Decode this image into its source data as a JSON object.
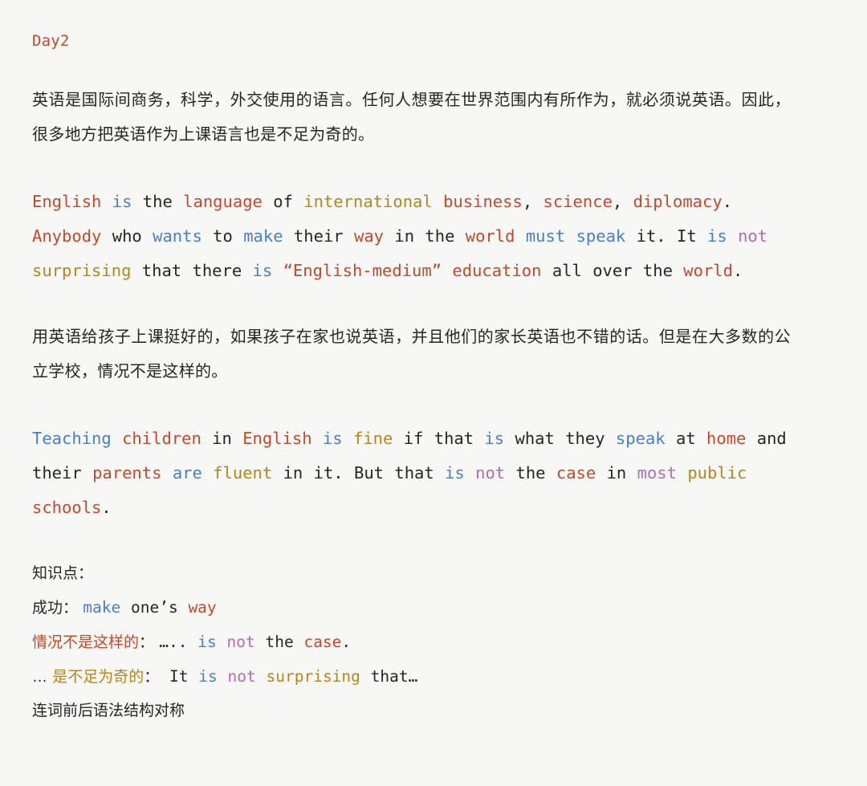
{
  "document": {
    "title": "Day2",
    "title_color": "#c4492b",
    "background_color": "#f7f7f5",
    "palette": {
      "red": "#c4492b",
      "blue": "#4a80c2",
      "gold": "#b5861d",
      "purple": "#b66cad",
      "dark": "#262626"
    }
  },
  "paragraph_cn_1": {
    "text": "英语是国际间商务，科学，外交使用的语言。任何人想要在世界范围内有所作为，就必须说英语。因此，很多地方把英语作为上课语言也是不足为奇的。"
  },
  "paragraph_en_1": {
    "tokens": [
      {
        "t": "English",
        "c": "red"
      },
      {
        "t": " ",
        "c": "dark"
      },
      {
        "t": "is",
        "c": "blue"
      },
      {
        "t": " the ",
        "c": "dark"
      },
      {
        "t": "language",
        "c": "red"
      },
      {
        "t": " of ",
        "c": "dark"
      },
      {
        "t": "international",
        "c": "gold"
      },
      {
        "t": " ",
        "c": "dark"
      },
      {
        "t": "business",
        "c": "red"
      },
      {
        "t": ", ",
        "c": "dark"
      },
      {
        "t": "science",
        "c": "red"
      },
      {
        "t": ", ",
        "c": "dark"
      },
      {
        "t": "diplomacy",
        "c": "red"
      },
      {
        "t": ". ",
        "c": "dark"
      },
      {
        "t": "Anybody",
        "c": "red"
      },
      {
        "t": " who ",
        "c": "dark"
      },
      {
        "t": "wants",
        "c": "blue"
      },
      {
        "t": " to ",
        "c": "dark"
      },
      {
        "t": "make",
        "c": "blue"
      },
      {
        "t": " their ",
        "c": "dark"
      },
      {
        "t": "way",
        "c": "red"
      },
      {
        "t": " in the ",
        "c": "dark"
      },
      {
        "t": "world",
        "c": "red"
      },
      {
        "t": " ",
        "c": "dark"
      },
      {
        "t": "must",
        "c": "blue"
      },
      {
        "t": " ",
        "c": "dark"
      },
      {
        "t": "speak",
        "c": "blue"
      },
      {
        "t": " it. It ",
        "c": "dark"
      },
      {
        "t": "is",
        "c": "blue"
      },
      {
        "t": " ",
        "c": "dark"
      },
      {
        "t": "not",
        "c": "purple"
      },
      {
        "t": " ",
        "c": "dark"
      },
      {
        "t": "surprising",
        "c": "gold"
      },
      {
        "t": " that there ",
        "c": "dark"
      },
      {
        "t": "is",
        "c": "blue"
      },
      {
        "t": " ",
        "c": "dark"
      },
      {
        "t": "“English-medium”",
        "c": "red"
      },
      {
        "t": " ",
        "c": "dark"
      },
      {
        "t": "education",
        "c": "red"
      },
      {
        "t": " all over the ",
        "c": "dark"
      },
      {
        "t": "world",
        "c": "red"
      },
      {
        "t": ".",
        "c": "dark"
      }
    ]
  },
  "paragraph_cn_2": {
    "text": "用英语给孩子上课挺好的，如果孩子在家也说英语，并且他们的家长英语也不错的话。但是在大多数的公立学校，情况不是这样的。"
  },
  "paragraph_en_2": {
    "tokens": [
      {
        "t": "Teaching",
        "c": "blue"
      },
      {
        "t": " ",
        "c": "dark"
      },
      {
        "t": "children",
        "c": "red"
      },
      {
        "t": " in ",
        "c": "dark"
      },
      {
        "t": "English",
        "c": "red"
      },
      {
        "t": " ",
        "c": "dark"
      },
      {
        "t": "is",
        "c": "blue"
      },
      {
        "t": " ",
        "c": "dark"
      },
      {
        "t": "fine",
        "c": "gold"
      },
      {
        "t": " if that ",
        "c": "dark"
      },
      {
        "t": "is",
        "c": "blue"
      },
      {
        "t": " what they ",
        "c": "dark"
      },
      {
        "t": "speak",
        "c": "blue"
      },
      {
        "t": " at ",
        "c": "dark"
      },
      {
        "t": "home",
        "c": "red"
      },
      {
        "t": " and their ",
        "c": "dark"
      },
      {
        "t": "parents",
        "c": "red"
      },
      {
        "t": " ",
        "c": "dark"
      },
      {
        "t": "are",
        "c": "blue"
      },
      {
        "t": " ",
        "c": "dark"
      },
      {
        "t": "fluent",
        "c": "gold"
      },
      {
        "t": " in it. But that ",
        "c": "dark"
      },
      {
        "t": "is",
        "c": "blue"
      },
      {
        "t": " ",
        "c": "dark"
      },
      {
        "t": "not",
        "c": "purple"
      },
      {
        "t": " the ",
        "c": "dark"
      },
      {
        "t": "case",
        "c": "red"
      },
      {
        "t": " in ",
        "c": "dark"
      },
      {
        "t": "most",
        "c": "purple"
      },
      {
        "t": " ",
        "c": "dark"
      },
      {
        "t": "public",
        "c": "gold"
      },
      {
        "t": " ",
        "c": "dark"
      },
      {
        "t": "schools",
        "c": "red"
      },
      {
        "t": ".",
        "c": "dark"
      }
    ]
  },
  "knowledge_points": {
    "heading": "知识点：",
    "items": [
      {
        "tokens": [
          {
            "t": "成功：  ",
            "c": "dark",
            "cn": true
          },
          {
            "t": "make",
            "c": "blue"
          },
          {
            "t": " one’s ",
            "c": "dark"
          },
          {
            "t": "way",
            "c": "red"
          }
        ]
      },
      {
        "tokens": [
          {
            "t": "情况不是这样的",
            "c": "red",
            "cn": true
          },
          {
            "t": "：  ",
            "c": "dark",
            "cn": true
          },
          {
            "t": "…..",
            "c": "dark"
          },
          {
            "t": " ",
            "c": "dark"
          },
          {
            "t": "is",
            "c": "blue"
          },
          {
            "t": " ",
            "c": "dark"
          },
          {
            "t": "not",
            "c": "purple"
          },
          {
            "t": " the ",
            "c": "dark"
          },
          {
            "t": "case",
            "c": "red"
          },
          {
            "t": ".",
            "c": "dark"
          }
        ]
      },
      {
        "tokens": [
          {
            "t": "… ",
            "c": "dark",
            "cn": true
          },
          {
            "t": "是不足为奇的",
            "c": "gold",
            "cn": true
          },
          {
            "t": "：",
            "c": "dark",
            "cn": true
          },
          {
            "t": " It ",
            "c": "dark"
          },
          {
            "t": "is",
            "c": "blue"
          },
          {
            "t": " ",
            "c": "dark"
          },
          {
            "t": "not",
            "c": "purple"
          },
          {
            "t": " ",
            "c": "dark"
          },
          {
            "t": "surprising",
            "c": "gold"
          },
          {
            "t": " that…",
            "c": "dark"
          }
        ]
      }
    ],
    "footer": "连词前后语法结构对称"
  }
}
